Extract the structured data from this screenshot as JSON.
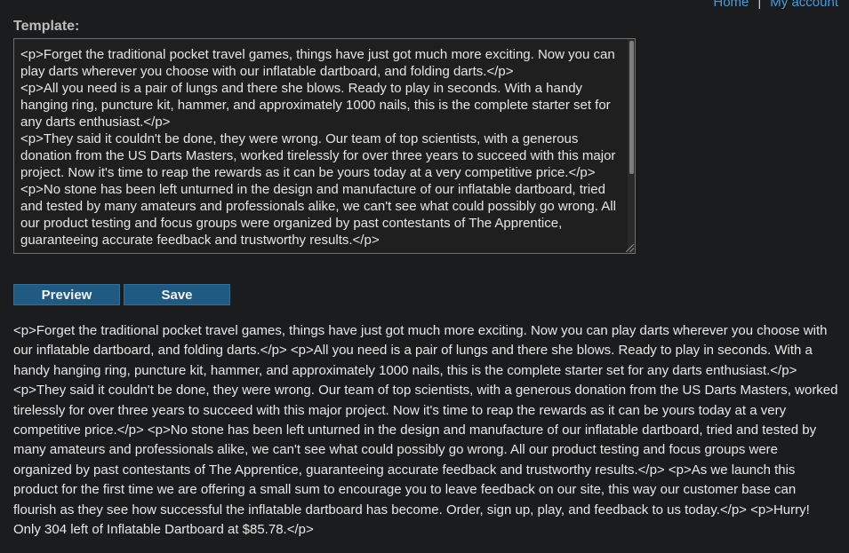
{
  "nav": {
    "home": "Home",
    "separator": "|",
    "account": "My account"
  },
  "template": {
    "label": "Template:",
    "lines": [
      "<p>Forget the traditional pocket travel games, things have just got much more exciting. Now you can play darts wherever you choose with our inflatable dartboard, and folding darts.</p>",
      "<p>All you need is a pair of lungs and there she blows. Ready to play in seconds. With a handy hanging ring, puncture kit, hammer, and approximately 1000 nails, this is the complete starter set for any darts enthusiast.</p>",
      "<p>They said it couldn't be done, they were wrong. Our team of top scientists, with a generous donation from the US Darts Masters, worked tirelessly for over three years to succeed with this major project. Now it's time to reap the rewards as it can be yours today at a very competitive price.</p>",
      "<p>No stone has been left unturned in the design and manufacture of our inflatable dartboard, tried and tested by many amateurs and professionals alike, we can't see what could possibly go wrong. All our product testing and focus groups were organized by past contestants of The Apprentice, guaranteeing accurate feedback and trustworthy results.</p>"
    ]
  },
  "buttons": {
    "preview": "Preview",
    "save": "Save"
  },
  "preview": {
    "text": "<p>Forget the traditional pocket travel games, things have just got much more exciting. Now you can play darts wherever you choose with our inflatable dartboard, and folding darts.</p> <p>All you need is a pair of lungs and there she blows. Ready to play in seconds. With a handy hanging ring, puncture kit, hammer, and approximately 1000 nails, this is the complete starter set for any darts enthusiast.</p> <p>They said it couldn't be done, they were wrong. Our team of top scientists, with a generous donation from the US Darts Masters, worked tirelessly for over three years to succeed with this major project. Now it's time to reap the rewards as it can be yours today at a very competitive price.</p> <p>No stone has been left unturned in the design and manufacture of our inflatable dartboard, tried and tested by many amateurs and professionals alike, we can't see what could possibly go wrong. All our product testing and focus groups were organized by past contestants of The Apprentice, guaranteeing accurate feedback and trustworthy results.</p> <p>As we launch this product for the first time we are offering a small sum to encourage you to leave feedback on our site, this way our customer base can flourish as they see how successful the inflatable dartboard has become. Order, sign up, play, and feedback to us today.</p> <p>Hurry! Only 304 left of Inflatable Dartboard at $85.78.</p>"
  },
  "colors": {
    "background": "#1b1c1e",
    "link": "#4a9bd8",
    "button": "#1f5a82"
  }
}
